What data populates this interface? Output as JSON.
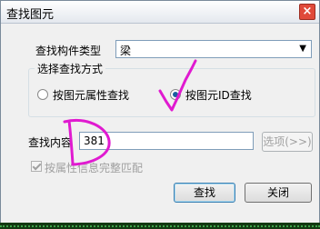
{
  "window": {
    "title": "查找图元",
    "close_glyph": "×"
  },
  "type_row": {
    "label": "查找构件类型",
    "selected": "梁",
    "arrow": "▼"
  },
  "method_group": {
    "legend": "选择查找方式",
    "options": [
      {
        "label": "按图元属性查找",
        "checked": false
      },
      {
        "label": "按图元ID查找",
        "checked": true
      }
    ]
  },
  "content_row": {
    "label": "查找内容",
    "value": "381",
    "options_button": "选项(>>)"
  },
  "match_checkbox": {
    "label": "按属性信息完整匹配",
    "checked": true,
    "enabled": false
  },
  "buttons": {
    "find": "查找",
    "close": "关闭"
  },
  "annotation_color": "#e01ad0"
}
